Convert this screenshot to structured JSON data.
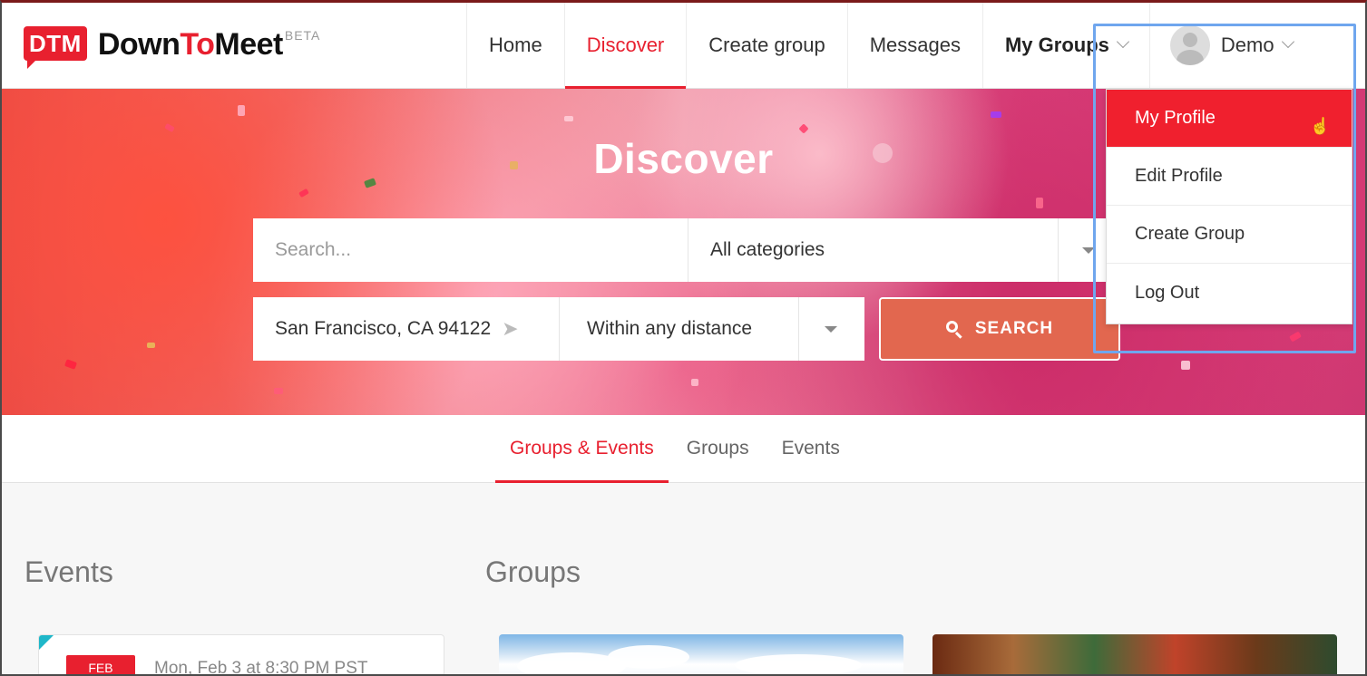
{
  "brand": {
    "badge": "DTM",
    "name_part1": "Down",
    "name_part2": "To",
    "name_part3": "Meet",
    "beta": "BETA",
    "accent_color": "#e8202f"
  },
  "nav": {
    "home": "Home",
    "discover": "Discover",
    "create_group": "Create group",
    "messages": "Messages",
    "my_groups": "My Groups",
    "user": "Demo"
  },
  "hero": {
    "title": "Discover"
  },
  "search": {
    "placeholder": "Search...",
    "category": "All categories",
    "location": "San Francisco, CA 94122",
    "distance": "Within any distance",
    "button": "SEARCH"
  },
  "tabs": [
    {
      "label": "Groups & Events",
      "active": true
    },
    {
      "label": "Groups",
      "active": false
    },
    {
      "label": "Events",
      "active": false
    }
  ],
  "sections": {
    "events_title": "Events",
    "groups_title": "Groups"
  },
  "event_card": {
    "month": "FEB",
    "date": "Mon, Feb 3 at 8:30 PM PST"
  },
  "user_menu": {
    "items": [
      {
        "label": "My Profile",
        "active": true
      },
      {
        "label": "Edit Profile",
        "active": false
      },
      {
        "label": "Create Group",
        "active": false
      },
      {
        "label": "Log Out",
        "active": false
      }
    ],
    "highlight_color": "#6fa6ee"
  }
}
